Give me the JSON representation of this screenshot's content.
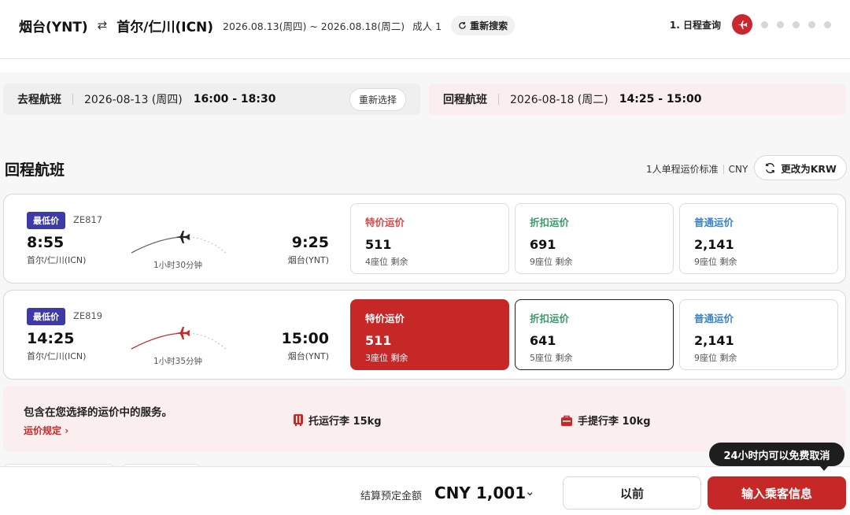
{
  "header": {
    "from": "烟台(YNT)",
    "swap_icon": "⇄",
    "to": "首尔/仁川(ICN)",
    "dates": "2026.08.13(周四) ~ 2026.08.18(周二)",
    "pax": "成人 1",
    "re_search": "重新搜索",
    "step_label": "1. 日程查询"
  },
  "selected": {
    "outbound": {
      "label": "去程航班",
      "date": "2026-08-13 (周四)",
      "time": "16:00 - 18:30",
      "reselect": "重新选择"
    },
    "return": {
      "label": "回程航班",
      "date": "2026-08-18 (周二)",
      "time": "14:25 - 15:00"
    }
  },
  "section": {
    "title": "回程航班",
    "fare_std": "1人单程运价标准",
    "currency": "CNY",
    "change_btn": "更改为KRW"
  },
  "flights": [
    {
      "badge": "最低价",
      "flight_no": "ZE817",
      "dep_time": "8:55",
      "dep_airport": "首尔/仁川(ICN)",
      "arr_time": "9:25",
      "arr_airport": "烟台(YNT)",
      "duration": "1小时30分钟",
      "fares": [
        {
          "name": "特价运价",
          "price": "511",
          "seats": "4座位 剩余"
        },
        {
          "name": "折扣运价",
          "price": "691",
          "seats": "9座位 剩余"
        },
        {
          "name": "普通运价",
          "price": "2,141",
          "seats": "9座位 剩余"
        }
      ]
    },
    {
      "badge": "最低价",
      "flight_no": "ZE819",
      "dep_time": "14:25",
      "dep_airport": "首尔/仁川(ICN)",
      "arr_time": "15:00",
      "arr_airport": "烟台(YNT)",
      "duration": "1小时35分钟",
      "fares": [
        {
          "name": "特价运价",
          "price": "511",
          "seats": "3座位 剩余"
        },
        {
          "name": "折扣运价",
          "price": "641",
          "seats": "5座位 剩余"
        },
        {
          "name": "普通运价",
          "price": "2,141",
          "seats": "9座位 剩余"
        }
      ]
    }
  ],
  "services": {
    "title": "包含在您选择的运价中的服务。",
    "rules_link": "运价规定",
    "checked_bag": "托运行李 15kg",
    "carry_on": "手提行李 10kg"
  },
  "bottom": {
    "total_label": "结算预定金额",
    "total_amount": "CNY 1,001",
    "prev": "以前",
    "next": "输入乘客信息",
    "tooltip": "24小时内可以免费取消"
  },
  "colors": {
    "accent": "#c62828",
    "badge": "#3d39a6",
    "special": "#d84848",
    "discount": "#3c9a6a",
    "normal": "#3a82c9"
  }
}
